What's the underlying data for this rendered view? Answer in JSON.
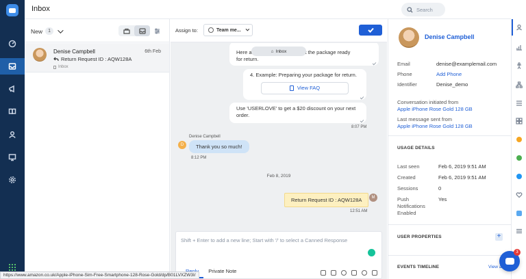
{
  "header": {
    "title": "Inbox",
    "search_placeholder": "Search"
  },
  "list": {
    "filter_label": "New",
    "filter_count": "1",
    "conversations": [
      {
        "name": "Denise Campbell",
        "date": "6th Feb",
        "subject": "Return Request ID : AQW128A",
        "inbox": "Inbox"
      }
    ]
  },
  "chat": {
    "assign_label": "Assign to:",
    "assignee": "Team me...",
    "inbox_pill": "Inbox",
    "msg1_line1": "Here are the instructions to get the package ready",
    "msg1_line2": "for return.",
    "msg2": "4. Example: Preparing your package for return.",
    "faq_label": "View FAQ",
    "msg3_line1": "Use 'USERLOVE' to get a $20 discount on your next",
    "msg3_line2": "order.",
    "time1": "8:07 PM",
    "customer_name": "Denise Campbell",
    "customer_initial": "D",
    "customer_msg": "Thank you so much!",
    "time2": "8:12 PM",
    "date_separator": "Feb 8, 2019",
    "agent_msg": "Return Request ID : AQW128A",
    "agent_initial": "M",
    "time3": "12:51 AM",
    "composer_placeholder": "Shift + Enter to add a new line; Start with '/' to select a Canned Response",
    "tab_reply": "Reply",
    "tab_note": "Private Note"
  },
  "contact": {
    "name": "Denise Campbell",
    "email_label": "Email",
    "email": "denise@examplemail.com",
    "phone_label": "Phone",
    "phone_action": "Add Phone",
    "identifier_label": "Identifier",
    "identifier": "Denise_demo",
    "initiated_label": "Conversation initiated from",
    "initiated_from": "Apple iPhone Rose Gold 128 GB",
    "last_label": "Last message sent from",
    "last_from": "Apple iPhone Rose Gold 128 GB",
    "usage_title": "USAGE DETAILS",
    "last_seen_label": "Last seen",
    "last_seen": "Feb 6, 2019 9:51 AM",
    "created_label": "Created",
    "created": "Feb 6, 2019 9:51 AM",
    "sessions_label": "Sessions",
    "sessions": "0",
    "push_label_1": "Push",
    "push_label_2": "Notifications",
    "push_label_3": "Enabled",
    "push_value": "Yes",
    "user_props_title": "USER PROPERTIES",
    "events_title": "EVENTS TIMELINE",
    "view_all": "View a"
  },
  "launcher": {
    "count": "3"
  },
  "statusbar": {
    "url": "https://www.amazon.co.uk/Apple-iPhone-Sim-Free-Smartphone-128-Rose-Gold/dp/B01LVXZW3I/"
  },
  "colors": {
    "nav_bg": "#132f52",
    "accent": "#1f5fd6",
    "customer_bubble": "#cfe3f7",
    "note_bg": "#fdf0c0"
  },
  "icons": [
    "chat-logo-icon",
    "dashboard-icon",
    "inbox-icon",
    "megaphone-icon",
    "book-icon",
    "user-icon",
    "report-icon",
    "settings-icon",
    "apps-grid-icon"
  ]
}
